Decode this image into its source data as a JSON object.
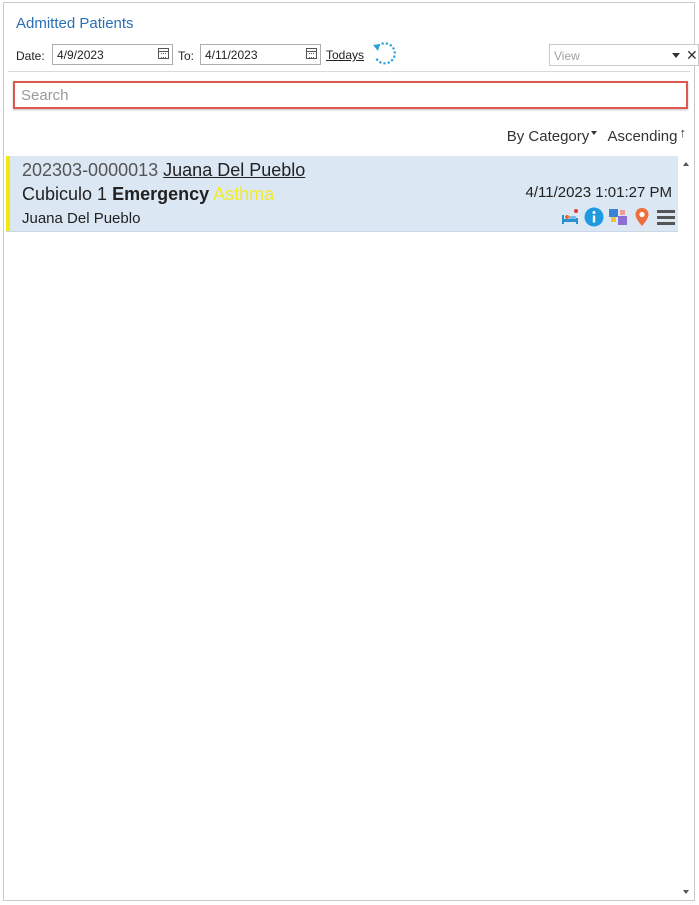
{
  "panel": {
    "title": "Admitted Patients"
  },
  "filters": {
    "date_label": "Date:",
    "date_from": "4/9/2023",
    "to_label": "To:",
    "date_to": "4/11/2023",
    "todays_label": "Todays",
    "view_placeholder": "View",
    "clear_symbol": "✕"
  },
  "search": {
    "placeholder": "Search",
    "value": ""
  },
  "sort": {
    "category_label": "By Category",
    "order_label": "Ascending"
  },
  "patients": [
    {
      "id": "202303-0000013",
      "name": "Juana Del Pueblo",
      "location": "Cubiculo 1",
      "category": "Emergency",
      "condition": "Asthma",
      "datetime": "4/11/2023 1:01:27 PM",
      "subtitle": "Juana Del Pueblo",
      "accent_color": "#f2e812",
      "icons": [
        "bed-icon",
        "info-icon",
        "transfer-icon",
        "location-pin-icon",
        "menu-icon"
      ]
    }
  ],
  "colors": {
    "title": "#2a6fb5",
    "search_border": "#e0574f",
    "row_background": "#dbe7f3",
    "condition_text": "#f0ec2a",
    "refresh_icon": "#29a3d9"
  }
}
